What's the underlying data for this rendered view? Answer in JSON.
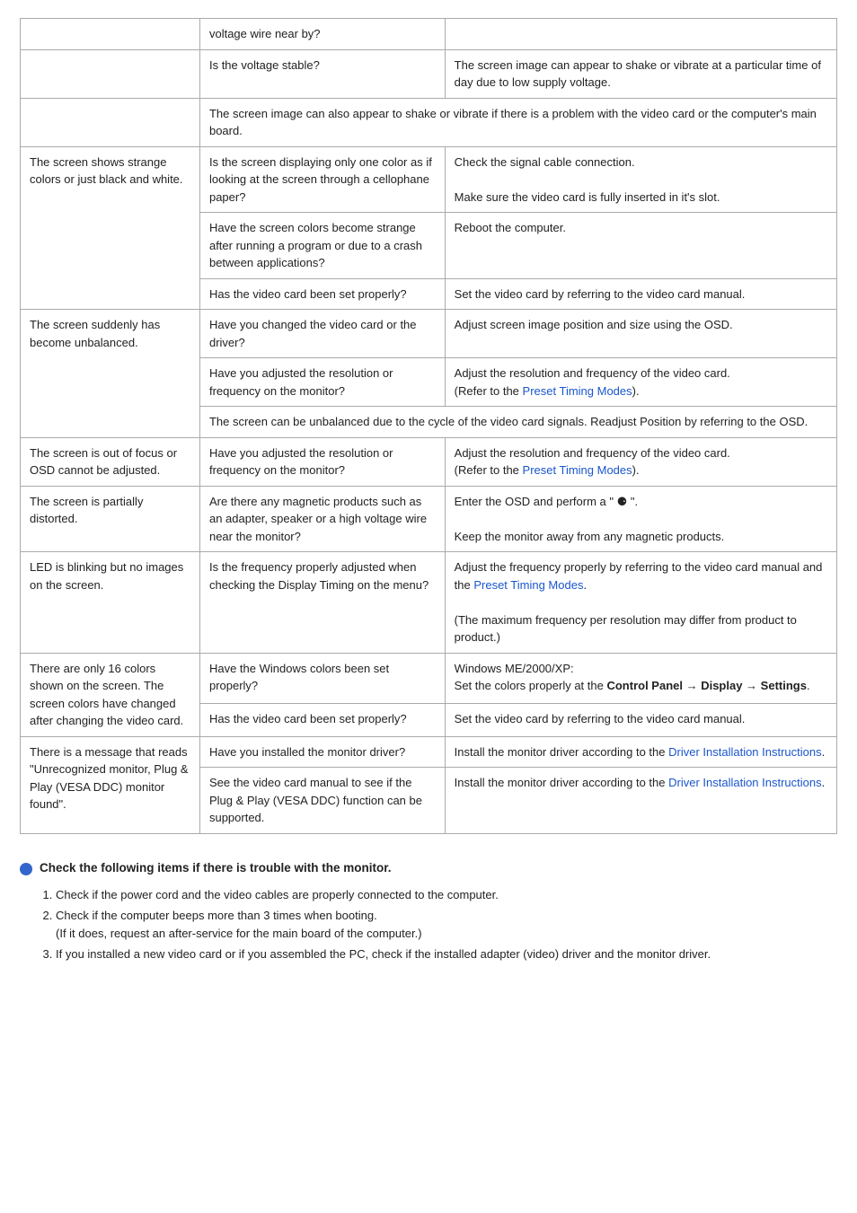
{
  "table": {
    "rows": [
      {
        "problem": "",
        "check": "voltage wire near by?",
        "solution": ""
      },
      {
        "problem": "",
        "check": "Is the voltage stable?",
        "solution": "The screen image can appear to shake or vibrate at a particular time of day due to low supply voltage."
      },
      {
        "problem": "",
        "check": "The screen image can also appear to shake or vibrate if there is a problem with the video card or the computer's main board.",
        "solution": "",
        "span": true
      },
      {
        "problem": "The screen shows strange colors or just black and white.",
        "check": "Is the screen displaying only one color as if looking at the screen through a cellophane paper?",
        "solution_parts": [
          "Check the signal cable connection.",
          "",
          "Make sure the video card is fully inserted in it's slot."
        ]
      },
      {
        "problem": "",
        "check": "Have the screen colors become strange after running a program or due to a crash between applications?",
        "solution": "Reboot the computer."
      },
      {
        "problem": "",
        "check": "Has the video card been set properly?",
        "solution": "Set the video card by referring to the video card manual."
      },
      {
        "problem": "The screen suddenly has become unbalanced.",
        "check": "Have you changed the video card or the driver?",
        "solution": "Adjust screen image position and size using the OSD."
      },
      {
        "problem": "",
        "check": "Have you adjusted the resolution or frequency on the monitor?",
        "solution_link": "Adjust the resolution and frequency of the video card.\n(Refer to the [Preset Timing Modes])."
      },
      {
        "problem": "",
        "check": "The screen can be unbalanced due to the cycle of the video card signals. Readjust Position by referring to the OSD.",
        "solution": "",
        "span": true
      },
      {
        "problem": "The screen is out of focus or OSD cannot be adjusted.",
        "check": "Have you adjusted the resolution or frequency on the monitor?",
        "solution_link": "Adjust the resolution and frequency of the video card.\n(Refer to the [Preset Timing Modes])."
      },
      {
        "problem": "The screen is partially distorted.",
        "check": "Are there any magnetic products such as an adapter, speaker or a high voltage wire near the monitor?",
        "solution_parts": [
          "Enter the OSD and perform a \" ⓧ \".",
          "",
          "Keep the monitor away from any magnetic products."
        ]
      },
      {
        "problem": "LED is blinking but no images on the screen.",
        "check": "Is the frequency properly adjusted when checking the Display Timing on the menu?",
        "solution_link": "Adjust the frequency properly by referring to the video card manual and the [Preset Timing Modes].\n\n(The maximum frequency per resolution may differ from product to product.)"
      },
      {
        "problem": "There are only 16 colors shown on the screen. The screen colors have changed after changing the video card.",
        "check": "Have the Windows colors been set properly?",
        "solution_bold": "Windows ME/2000/XP:\nSet the colors properly at the [Control Panel → Display → Settings]."
      },
      {
        "problem": "",
        "check": "Has the video card been set properly?",
        "solution": "Set the video card by referring to the video card manual."
      },
      {
        "problem": "There is a message that reads \"Unrecognized monitor, Plug & Play (VESA DDC) monitor found\".",
        "check": "Have you installed the monitor driver?",
        "solution_link2": "Install the monitor driver according to the [Driver Installation Instructions]."
      },
      {
        "problem": "",
        "check": "See the video card manual to see if the Plug & Play (VESA DDC) function can be supported.",
        "solution_link2": "Install the monitor driver according to the [Driver Installation Instructions]."
      }
    ]
  },
  "bottom": {
    "header": "Check the following items if there is trouble with the monitor.",
    "items": [
      {
        "num": "1.",
        "text": "Check if the power cord and the video cables are properly connected to the computer."
      },
      {
        "num": "2.",
        "text": "Check if the computer beeps more than 3 times when booting.",
        "sub": "(If it does, request an after-service for the main board of the computer.)"
      },
      {
        "num": "3.",
        "text": "If you installed a new video card or if you assembled the PC, check if the installed adapter (video) driver and the monitor driver."
      }
    ]
  },
  "links": {
    "preset_timing": "Preset Timing Modes",
    "driver_install": "Driver Installation Instructions"
  }
}
